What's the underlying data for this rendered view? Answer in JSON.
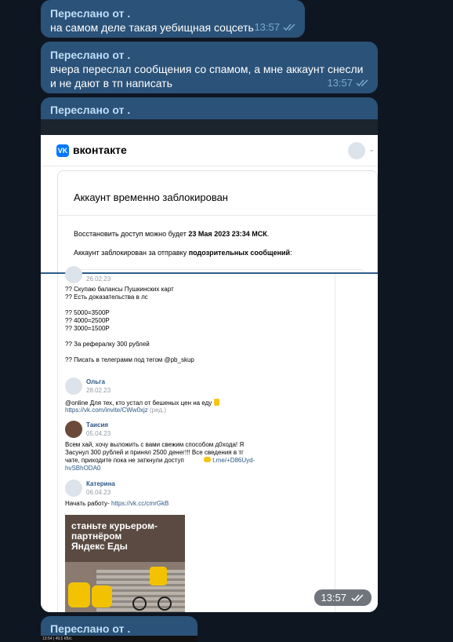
{
  "messages": [
    {
      "forwarded_label": "Переслано от .",
      "text": "на самом деле такая уебищная соцсеть",
      "time": "13:57"
    },
    {
      "forwarded_label": "Переслано от .",
      "text": "вчера переслал сообщения со спамом, а мне аккаунт снесли и не дают в тп написать",
      "time": "13:57"
    },
    {
      "forwarded_label": "Переслано от .",
      "time": "13:57",
      "screenshot": {
        "brand": "вконтакте",
        "card_title": "Аккаунт временно заблокирован",
        "restore_prefix": "Восстановить доступ можно будет ",
        "restore_date": "23 Мая 2023 23:34 МСК",
        "restore_suffix": ".",
        "reason_prefix": "Аккаунт заблокирован за отправку ",
        "reason_bold": "подозрительных сообщений",
        "reason_suffix": ":",
        "post1": {
          "date": "26.02.23",
          "lines": "?? Скупаю балансы Пушкинских карт\n?? Есть доказательства в лс\n\n?? 5000=3500Р\n?? 4000=2500Р\n?? 3000=1500Р\n\n?? За рефералку 300 рублей\n\n?? Писать в телеграмм под тегом @pb_skup"
        },
        "post2": {
          "name": "Ольга",
          "date": "28.02.23",
          "text": "@online Для тех, кто устал от бешеных цен на еду",
          "link": "https://vk.com/invite/CWw0xjz",
          "link_note": "(ред.)"
        },
        "post3": {
          "name": "Таисия",
          "date": "05.04.23",
          "text": "Всем хай, хочу выложить с вами свежим способом д0хода! Я\nЗасунул 300 рублей и принял 2500 денег!!! Все сведения в тг\nчате, приходите пока не заткнули доступ",
          "link_a": "t.me/+D86Uyd-",
          "link_b": "hvSBhODA0"
        },
        "post4": {
          "name": "Катерина",
          "date": "06.04.23",
          "text": "Начать работу- ",
          "link": "https://vk.cc/cmrGkB"
        },
        "ad_text": "станьте курьером-\nпартнёром\nЯндекс Еды"
      }
    },
    {
      "forwarded_label": "Переслано от ."
    }
  ],
  "status_bar": "13:54 | 49,5 КБ/с"
}
